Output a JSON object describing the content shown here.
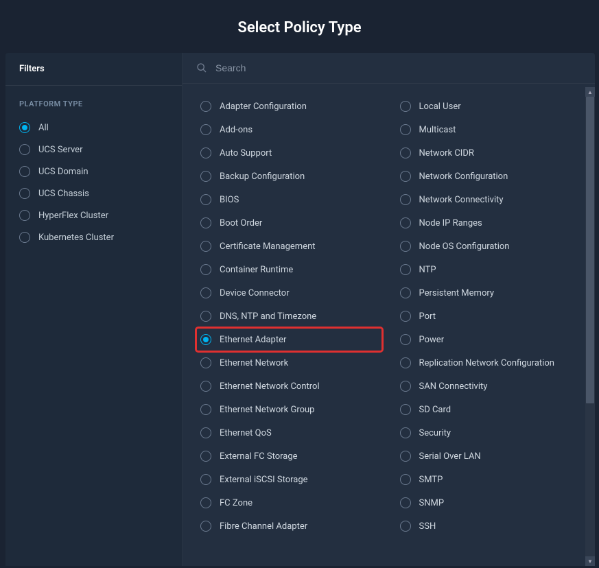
{
  "header": {
    "title": "Select Policy Type"
  },
  "sidebar": {
    "title": "Filters",
    "section_title": "PLATFORM TYPE",
    "items": [
      {
        "label": "All",
        "selected": true
      },
      {
        "label": "UCS Server",
        "selected": false
      },
      {
        "label": "UCS Domain",
        "selected": false
      },
      {
        "label": "UCS Chassis",
        "selected": false
      },
      {
        "label": "HyperFlex Cluster",
        "selected": false
      },
      {
        "label": "Kubernetes Cluster",
        "selected": false
      }
    ]
  },
  "search": {
    "placeholder": "Search",
    "value": ""
  },
  "policies": {
    "col1": [
      {
        "label": "Adapter Configuration",
        "selected": false,
        "highlighted": false
      },
      {
        "label": "Add-ons",
        "selected": false,
        "highlighted": false
      },
      {
        "label": "Auto Support",
        "selected": false,
        "highlighted": false
      },
      {
        "label": "Backup Configuration",
        "selected": false,
        "highlighted": false
      },
      {
        "label": "BIOS",
        "selected": false,
        "highlighted": false
      },
      {
        "label": "Boot Order",
        "selected": false,
        "highlighted": false
      },
      {
        "label": "Certificate Management",
        "selected": false,
        "highlighted": false
      },
      {
        "label": "Container Runtime",
        "selected": false,
        "highlighted": false
      },
      {
        "label": "Device Connector",
        "selected": false,
        "highlighted": false
      },
      {
        "label": "DNS, NTP and Timezone",
        "selected": false,
        "highlighted": false
      },
      {
        "label": "Ethernet Adapter",
        "selected": true,
        "highlighted": true
      },
      {
        "label": "Ethernet Network",
        "selected": false,
        "highlighted": false
      },
      {
        "label": "Ethernet Network Control",
        "selected": false,
        "highlighted": false
      },
      {
        "label": "Ethernet Network Group",
        "selected": false,
        "highlighted": false
      },
      {
        "label": "Ethernet QoS",
        "selected": false,
        "highlighted": false
      },
      {
        "label": "External FC Storage",
        "selected": false,
        "highlighted": false
      },
      {
        "label": "External iSCSI Storage",
        "selected": false,
        "highlighted": false
      },
      {
        "label": "FC Zone",
        "selected": false,
        "highlighted": false
      },
      {
        "label": "Fibre Channel Adapter",
        "selected": false,
        "highlighted": false
      }
    ],
    "col2": [
      {
        "label": "Local User",
        "selected": false,
        "highlighted": false
      },
      {
        "label": "Multicast",
        "selected": false,
        "highlighted": false
      },
      {
        "label": "Network CIDR",
        "selected": false,
        "highlighted": false
      },
      {
        "label": "Network Configuration",
        "selected": false,
        "highlighted": false
      },
      {
        "label": "Network Connectivity",
        "selected": false,
        "highlighted": false
      },
      {
        "label": "Node IP Ranges",
        "selected": false,
        "highlighted": false
      },
      {
        "label": "Node OS Configuration",
        "selected": false,
        "highlighted": false
      },
      {
        "label": "NTP",
        "selected": false,
        "highlighted": false
      },
      {
        "label": "Persistent Memory",
        "selected": false,
        "highlighted": false
      },
      {
        "label": "Port",
        "selected": false,
        "highlighted": false
      },
      {
        "label": "Power",
        "selected": false,
        "highlighted": false
      },
      {
        "label": "Replication Network Configuration",
        "selected": false,
        "highlighted": false
      },
      {
        "label": "SAN Connectivity",
        "selected": false,
        "highlighted": false
      },
      {
        "label": "SD Card",
        "selected": false,
        "highlighted": false
      },
      {
        "label": "Security",
        "selected": false,
        "highlighted": false
      },
      {
        "label": "Serial Over LAN",
        "selected": false,
        "highlighted": false
      },
      {
        "label": "SMTP",
        "selected": false,
        "highlighted": false
      },
      {
        "label": "SNMP",
        "selected": false,
        "highlighted": false
      },
      {
        "label": "SSH",
        "selected": false,
        "highlighted": false
      }
    ]
  }
}
